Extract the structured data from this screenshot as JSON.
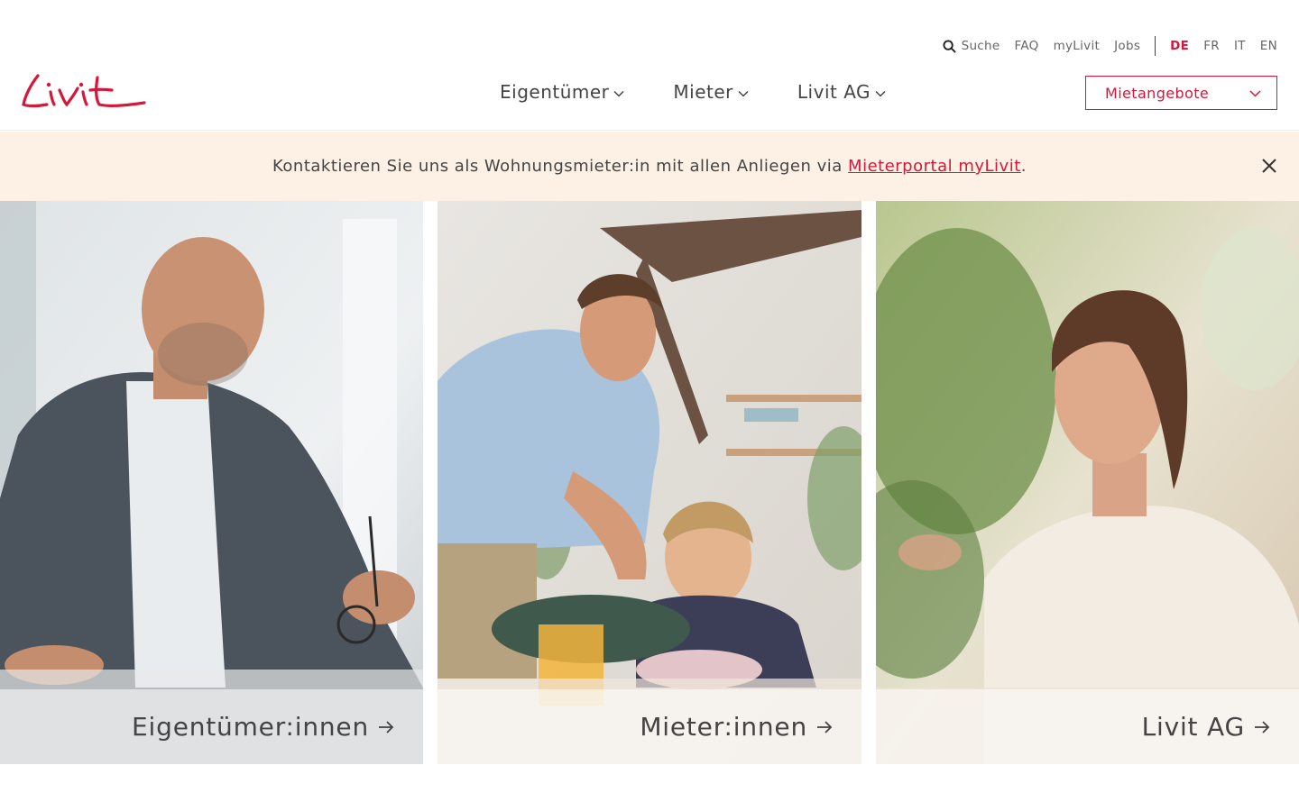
{
  "brand": {
    "name": "Livit",
    "accent_color": "#d6173a",
    "banner_bg": "#fdf1e5"
  },
  "topbar": {
    "search_label": "Suche",
    "links": [
      "FAQ",
      "myLivit",
      "Jobs"
    ],
    "languages": [
      "DE",
      "FR",
      "IT",
      "EN"
    ],
    "active_language": "DE"
  },
  "mainnav": {
    "items": [
      {
        "label": "Eigentümer"
      },
      {
        "label": "Mieter"
      },
      {
        "label": "Livit AG"
      }
    ]
  },
  "offers_dropdown": {
    "label": "Mietangebote"
  },
  "banner": {
    "text_before": "Kontaktieren Sie uns als Wohnungsmieter:in mit allen Anliegen via ",
    "link_text": "Mieterportal myLivit",
    "text_after": "."
  },
  "tiles": [
    {
      "label": "Eigentümer:innen",
      "photo": "businessman-smiling-photo"
    },
    {
      "label": "Mieter:innen",
      "photo": "father-daughter-cooking-photo"
    },
    {
      "label": "Livit AG",
      "photo": "woman-laughing-photo"
    }
  ],
  "icons": {
    "search": "search-icon",
    "chevron": "chevron-down-icon",
    "close": "close-icon",
    "arrow": "arrow-right-icon"
  }
}
